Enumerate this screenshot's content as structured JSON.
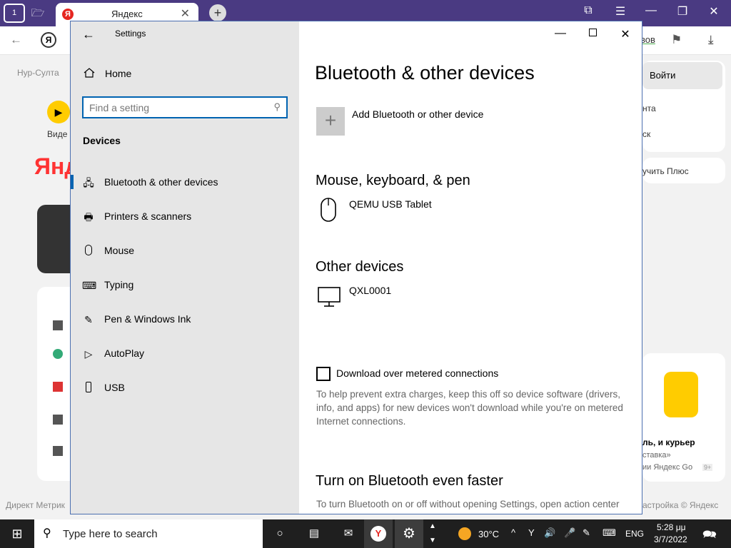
{
  "browser": {
    "tab_title": "Яндекс",
    "tab_favicon": "Я",
    "home_badge": "1",
    "address_partial": "вов"
  },
  "ypage": {
    "location": "Нур-Султа",
    "video_label": "Виде",
    "logo_partial": "Янд",
    "login": "Войти",
    "right_item1": "нта",
    "right_item2": "ск",
    "plus": "учить Плюс",
    "promo_title": "ль, и курьер",
    "promo_line2": "ставка»",
    "promo_line3": "ии Яндекс Go",
    "promo_badge": "9+",
    "footer_left": "Директ  Метрик",
    "footer_right": "астройка  © Яндекс"
  },
  "settings": {
    "app_title": "Settings",
    "home": "Home",
    "search_placeholder": "Find a setting",
    "category": "Devices",
    "nav": [
      {
        "label": "Bluetooth & other devices",
        "icon": "bluetooth-devices-icon",
        "selected": true
      },
      {
        "label": "Printers & scanners",
        "icon": "printer-icon"
      },
      {
        "label": "Mouse",
        "icon": "mouse-icon"
      },
      {
        "label": "Typing",
        "icon": "keyboard-icon"
      },
      {
        "label": "Pen & Windows Ink",
        "icon": "pen-icon"
      },
      {
        "label": "AutoPlay",
        "icon": "autoplay-icon"
      },
      {
        "label": "USB",
        "icon": "usb-icon"
      }
    ],
    "main": {
      "title": "Bluetooth & other devices",
      "add_device": "Add Bluetooth or other device",
      "section_mouse": "Mouse, keyboard, & pen",
      "device_mouse": "QEMU USB Tablet",
      "section_other": "Other devices",
      "device_other": "QXL0001",
      "metered_label": "Download over metered connections",
      "metered_checked": false,
      "metered_desc": "To help prevent extra charges, keep this off so device software (drivers, info, and apps) for new devices won't download while you're on metered Internet connections.",
      "faster_title": "Turn on Bluetooth even faster",
      "faster_desc": "To turn Bluetooth on or off without opening Settings, open action center and select the Bluetooth icon."
    }
  },
  "taskbar": {
    "search_placeholder": "Type here to search",
    "temperature": "30°C",
    "language": "ENG",
    "time": "5:28 μμ",
    "date": "3/7/2022"
  },
  "colors": {
    "accent": "#0063b1",
    "titlebar": "#4a3a82",
    "yandex_red": "#e52620"
  }
}
